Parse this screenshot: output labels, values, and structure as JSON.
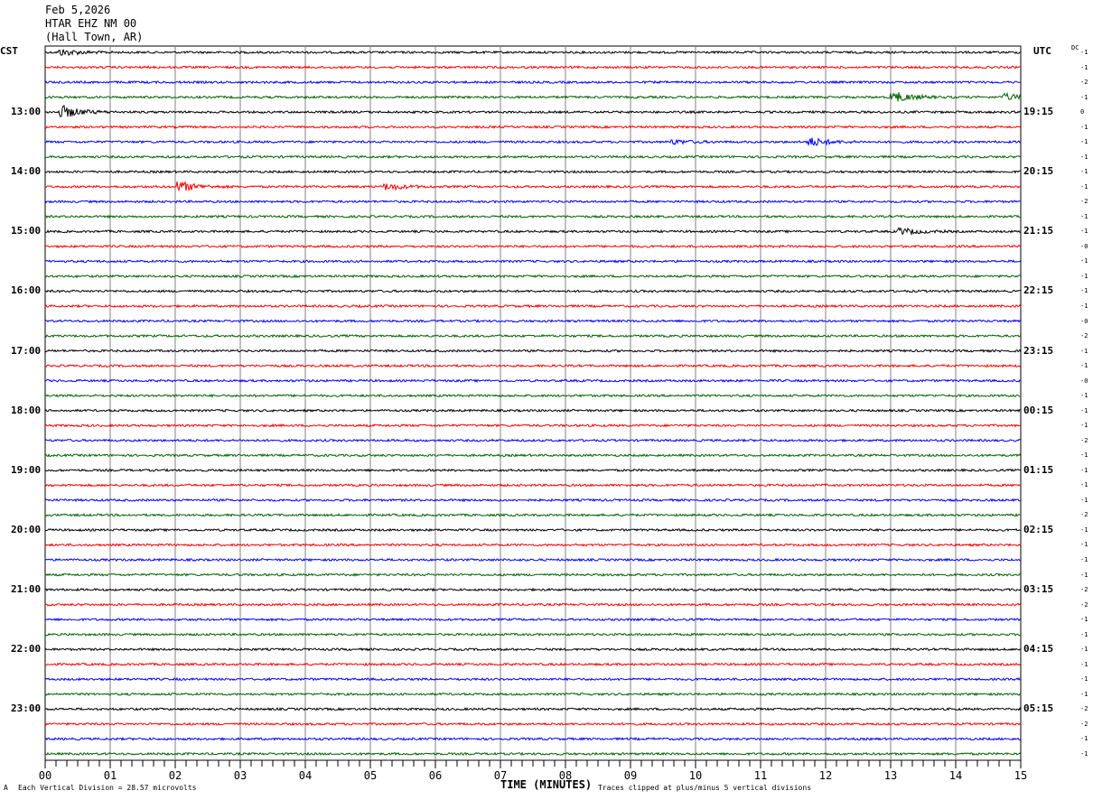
{
  "header": {
    "date": "Feb 5,2026",
    "station": "HTAR EHZ NM 00",
    "location": "(Hall Town, AR)"
  },
  "left_tz": "CST",
  "right_tz": "UTC",
  "dc_label": "DC",
  "footer": {
    "scale": "Each Vertical Division =   28.57 microvolts",
    "xlabel": "TIME (MINUTES)",
    "clip_note": "Traces clipped at plus/minus 5 vertical divisions",
    "corner": "A"
  },
  "chart_data": {
    "type": "line",
    "title": "HTAR EHZ NM 00 helicorder",
    "xlabel": "TIME (MINUTES)",
    "xlim": [
      0,
      15
    ],
    "x_ticks": [
      "00",
      "01",
      "02",
      "03",
      "04",
      "05",
      "06",
      "07",
      "08",
      "09",
      "10",
      "11",
      "12",
      "13",
      "14",
      "15"
    ],
    "trace_colors": [
      "#000000",
      "#ff0000",
      "#0000ff",
      "#006400"
    ],
    "rows_per_hour": 4,
    "left_hour_labels": [
      "13:00",
      "14:00",
      "15:00",
      "16:00",
      "17:00",
      "18:00",
      "19:00",
      "20:00",
      "21:00",
      "22:00",
      "23:00"
    ],
    "right_hour_labels": [
      "19:15",
      "20:15",
      "21:15",
      "22:15",
      "23:15",
      "00:15",
      "01:15",
      "02:15",
      "03:15",
      "04:15",
      "05:15"
    ],
    "dc_offsets": [
      "-1",
      "-1",
      "-2",
      "-1",
      "0",
      "-1",
      "-1",
      "-1",
      "-1",
      "-1",
      "-2",
      "-1",
      "-1",
      "-0",
      "-1",
      "-1",
      "-1",
      "-1",
      "-0",
      "-2",
      "-1",
      "-1",
      "-0",
      "-1",
      "-1",
      "-1",
      "-2",
      "-1",
      "-1",
      "-1",
      "-1",
      "-2",
      "-1",
      "-1",
      "-1",
      "-1",
      "-2",
      "-2",
      "-1",
      "-1",
      "-1",
      "-1",
      "-1",
      "-1",
      "-2",
      "-2",
      "-1",
      "-1"
    ],
    "events": [
      {
        "row": 0,
        "minute": 0.3,
        "amp": 3
      },
      {
        "row": 3,
        "minute": 13.1,
        "amp": 5
      },
      {
        "row": 3,
        "minute": 14.8,
        "amp": 3
      },
      {
        "row": 4,
        "minute": 0.3,
        "amp": 6
      },
      {
        "row": 6,
        "minute": 11.8,
        "amp": 4
      },
      {
        "row": 6,
        "minute": 9.7,
        "amp": 2
      },
      {
        "row": 9,
        "minute": 2.1,
        "amp": 5
      },
      {
        "row": 9,
        "minute": 5.3,
        "amp": 3
      },
      {
        "row": 12,
        "minute": 13.2,
        "amp": 3
      }
    ]
  }
}
